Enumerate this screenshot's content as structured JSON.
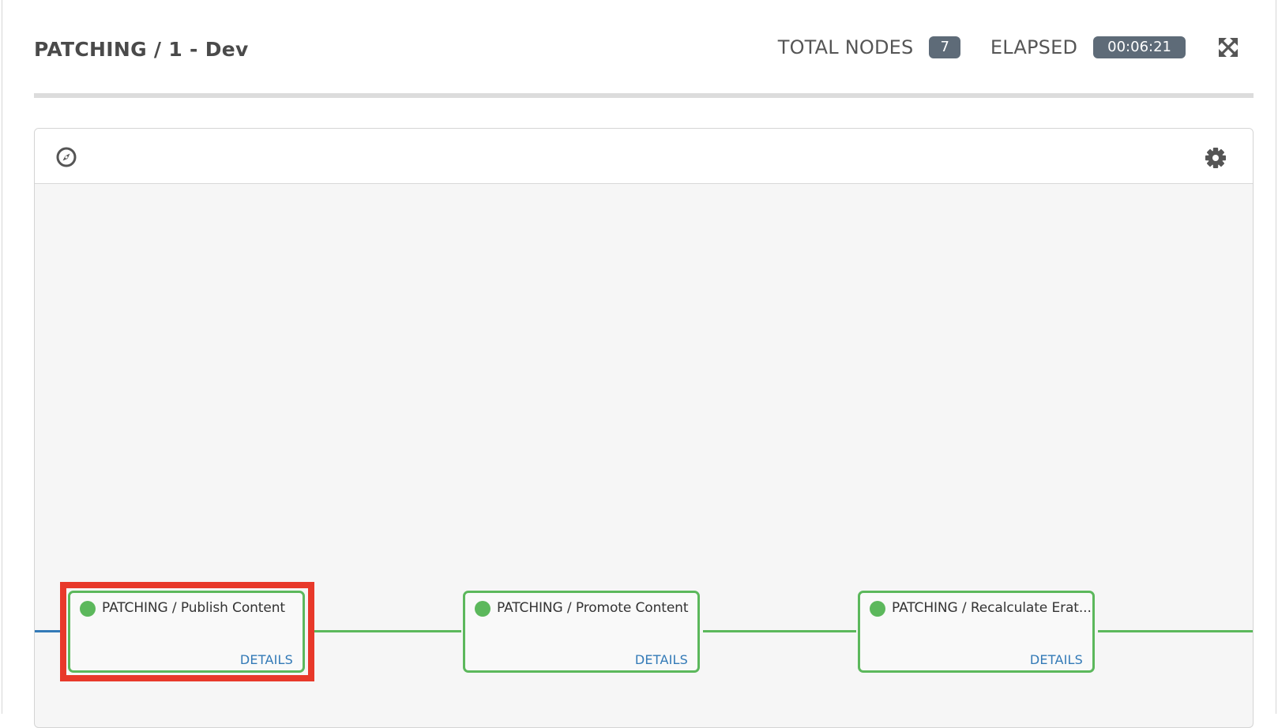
{
  "header": {
    "title": "PATCHING / 1 - Dev",
    "total_nodes_label": "TOTAL NODES",
    "total_nodes_value": "7",
    "elapsed_label": "ELAPSED",
    "elapsed_value": "00:06:21",
    "expand_icon": "expand-arrows-icon"
  },
  "toolbar": {
    "compass_icon": "compass-icon",
    "settings_icon": "gear-icon"
  },
  "nodes": [
    {
      "name": "PATCHING / Publish Content",
      "details_label": "DETAILS",
      "status": "success"
    },
    {
      "name": "PATCHING / Promote Content",
      "details_label": "DETAILS",
      "status": "success"
    },
    {
      "name": "PATCHING / Recalculate Erat...",
      "details_label": "DETAILS",
      "status": "success"
    }
  ],
  "colors": {
    "success": "#5cb85c",
    "link_start": "#337ab7",
    "link_success": "#5cb85c",
    "highlight": "#e8392a",
    "badge": "#5e6b78"
  }
}
